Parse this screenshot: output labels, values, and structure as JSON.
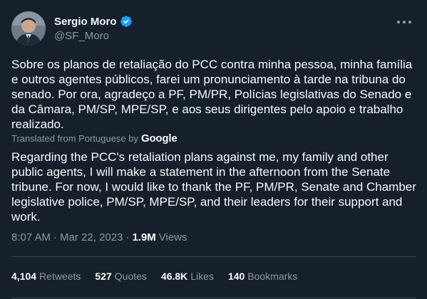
{
  "author": {
    "name": "Sergio Moro",
    "handle": "@SF_Moro",
    "verified_color": "#1d9bf0"
  },
  "tweet": {
    "original_text": "Sobre os planos de retaliação do PCC contra minha pessoa, minha família e outros agentes públicos, farei um pronunciamento à tarde na tribuna do senado. Por ora, agradeço a PF, PM/PR, Polícias legislativas do Senado e da Câmara, PM/SP, MPE/SP, e aos seus dirigentes pelo apoio e trabalho realizado.",
    "translated_label": "Translated from Portuguese by",
    "translator": "Google",
    "translated_text": "Regarding the PCC's retaliation plans against me, my family and other public agents, I will make a statement in the afternoon from the Senate tribune. For now, I would like to thank the PF, PM/PR, Senate and Chamber legislative police, PM/SP, MPE/SP, and their leaders for their support and work.",
    "time": "8:07 AM",
    "separator": "·",
    "date": "Mar 22, 2023",
    "views_count": "1.9M",
    "views_label": "Views"
  },
  "stats": [
    {
      "count": "4,104",
      "label": "Retweets"
    },
    {
      "count": "527",
      "label": "Quotes"
    },
    {
      "count": "46.8K",
      "label": "Likes"
    },
    {
      "count": "140",
      "label": "Bookmarks"
    }
  ],
  "icons": {
    "more": "more-options-icon",
    "verified": "verified-badge-icon"
  }
}
